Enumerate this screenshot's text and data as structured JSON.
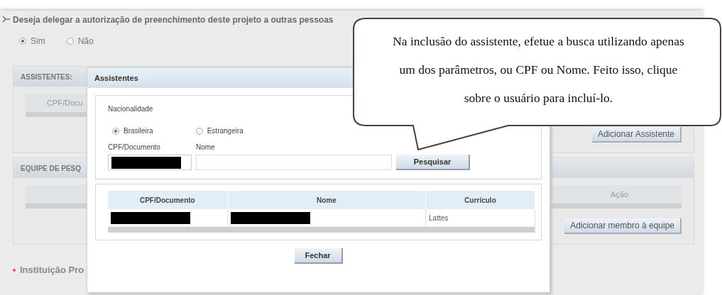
{
  "question": {
    "text": "Deseja delegar a autorização de preenchimento deste projeto a outras pessoas",
    "options": [
      {
        "label": "Sim",
        "selected": true
      },
      {
        "label": "Não",
        "selected": false
      }
    ]
  },
  "sections": [
    {
      "title": "ASSISTENTES:",
      "columns": [
        {
          "label": "CPF/Docu",
          "kind": "data"
        }
      ],
      "button": "Adicionar Assistente"
    },
    {
      "title": "EQUIPE DE PESQ",
      "columns": [
        {
          "label": "Ação",
          "kind": "action"
        }
      ],
      "button": "Adicionar membro à equipe"
    }
  ],
  "required_field": {
    "label": "Instituição Pro"
  },
  "dialog": {
    "title": "Assistentes",
    "nationality": {
      "label": "Nacionalidade",
      "options": [
        {
          "label": "Brasileira",
          "selected": true
        },
        {
          "label": "Estrangeira",
          "selected": false
        }
      ]
    },
    "fields": [
      {
        "label": "CPF/Documento",
        "redacted": true
      },
      {
        "label": "Nome"
      }
    ],
    "search_button": "Pesquisar",
    "results": {
      "columns": [
        "CPF/Documento",
        "Nome",
        "Currículo"
      ],
      "rows": [
        {
          "cells": [
            {
              "redacted": true
            },
            {
              "redacted": true
            },
            {
              "text": "Lattes",
              "redacted": false
            }
          ]
        }
      ]
    },
    "close_button": "Fechar"
  },
  "callout": {
    "text": "Na inclusão do assistente, efetue a busca utilizando apenas um dos parâmetros, ou CPF ou Nome. Feito isso, clique sobre o usuário para incluí-lo."
  }
}
